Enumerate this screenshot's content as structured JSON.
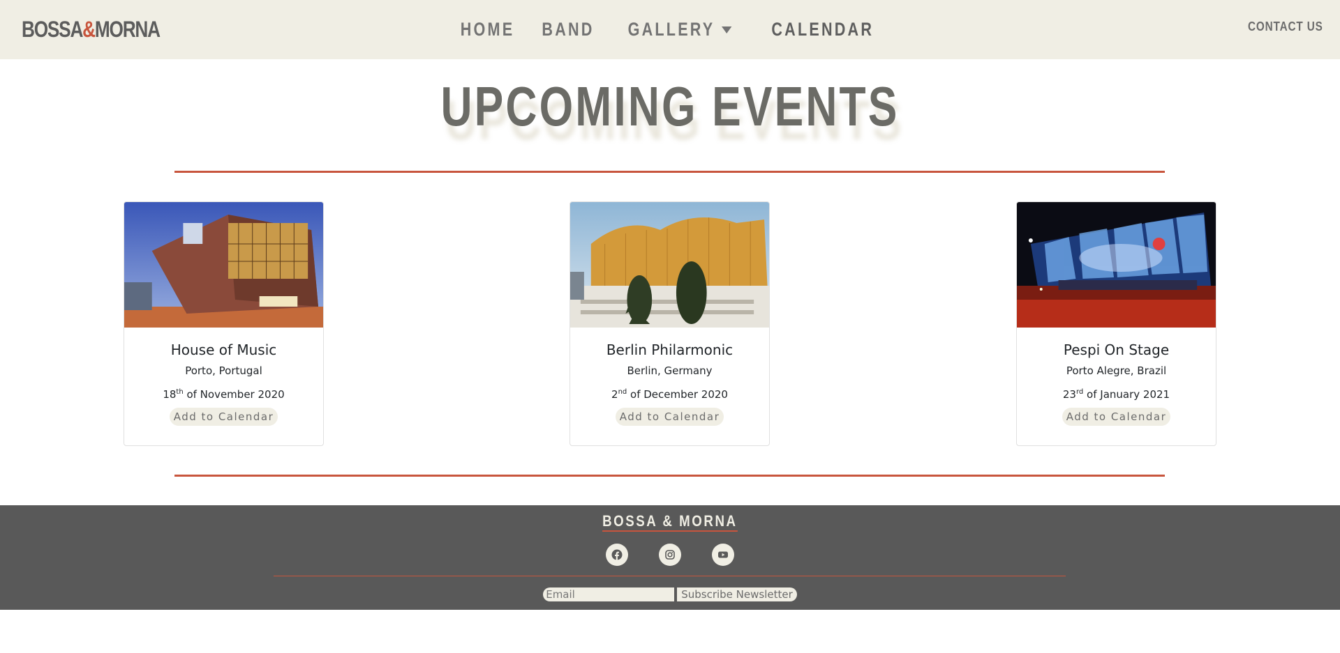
{
  "navbar": {
    "logo_left": "BOSSA",
    "logo_amp": "&",
    "logo_right": "MORNA",
    "links": [
      {
        "label": "HOME"
      },
      {
        "label": "BAND"
      },
      {
        "label": "GALLERY"
      },
      {
        "label": "CALENDAR"
      }
    ],
    "contact_label": "CONTACT US"
  },
  "main": {
    "title": "UPCOMING EVENTS",
    "add_to_calendar_label": "Add to Calendar",
    "events": [
      {
        "name": "House of Music",
        "location": "Porto, Portugal",
        "day": "18",
        "suffix": "th",
        "rest": " of November 2020"
      },
      {
        "name": "Berlin Philarmonic",
        "location": "Berlin, Germany",
        "day": "2",
        "suffix": "nd",
        "rest": " of December 2020"
      },
      {
        "name": "Pespi On Stage",
        "location": "Porto Alegre, Brazil",
        "day": "23",
        "suffix": "rd",
        "rest": " of January 2021"
      }
    ]
  },
  "footer": {
    "brand": "BOSSA & MORNA",
    "social": [
      "facebook-icon",
      "instagram-icon",
      "youtube-icon"
    ],
    "email_placeholder": "Email",
    "subscribe_label": "Subscribe Newsletter"
  },
  "colors": {
    "accent": "#c8553d",
    "cream": "#f0eee4",
    "footer_bg": "#595959"
  }
}
